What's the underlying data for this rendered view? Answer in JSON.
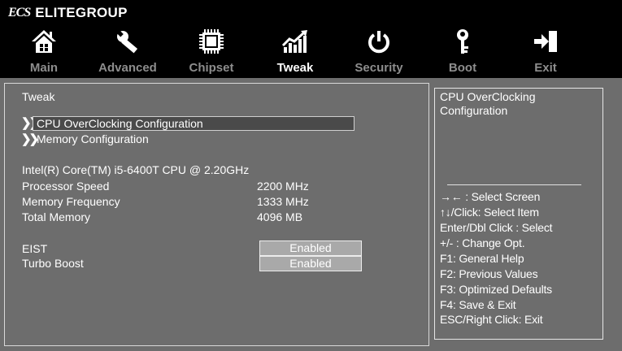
{
  "brand": {
    "mark": "ECS",
    "name": "ELITEGROUP"
  },
  "nav": {
    "tabs": [
      {
        "label": "Main",
        "icon": "home-icon"
      },
      {
        "label": "Advanced",
        "icon": "wrench-icon"
      },
      {
        "label": "Chipset",
        "icon": "chip-icon"
      },
      {
        "label": "Tweak",
        "icon": "chart-icon"
      },
      {
        "label": "Security",
        "icon": "power-icon"
      },
      {
        "label": "Boot",
        "icon": "key-icon"
      },
      {
        "label": "Exit",
        "icon": "exit-icon"
      }
    ],
    "active": "Tweak"
  },
  "main": {
    "section_title": "Tweak",
    "menu_items": [
      "CPU OverClocking Configuration",
      "Memory Configuration"
    ],
    "cpu_name": "Intel(R) Core(TM) i5-6400T CPU @ 2.20GHz",
    "info": [
      {
        "label": "Processor Speed",
        "value": "2200 MHz"
      },
      {
        "label": "Memory Frequency",
        "value": "1333 MHz"
      },
      {
        "label": "Total Memory",
        "value": "4096 MB"
      }
    ],
    "options": [
      {
        "label": "EIST",
        "value": "Enabled"
      },
      {
        "label": "Turbo Boost",
        "value": "Enabled"
      }
    ]
  },
  "help": {
    "title": "CPU OverClocking Configuration",
    "keys": [
      "→←  : Select Screen",
      "↑↓/Click: Select Item",
      "Enter/Dbl Click : Select",
      "+/- : Change Opt.",
      "F1: General Help",
      "F2: Previous Values",
      "F3: Optimized Defaults",
      "F4: Save & Exit",
      "ESC/Right Click: Exit"
    ]
  },
  "colors": {
    "background": "#6d6d6d",
    "topbar": "#000000",
    "tab_inactive": "#8d8d8d",
    "tab_active": "#ffffff",
    "option_fill": "#a9a9a9"
  }
}
